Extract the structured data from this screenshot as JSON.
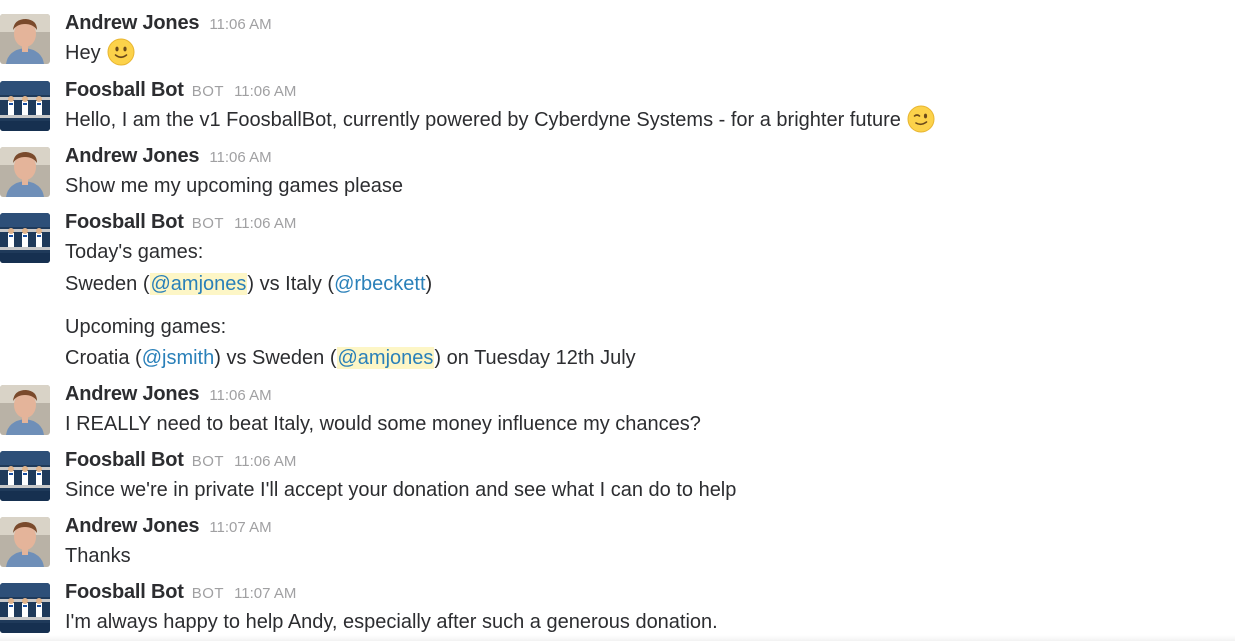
{
  "messages": [
    {
      "author": "Andrew Jones",
      "is_bot": false,
      "time": "11:06 AM",
      "lines": [
        "Hey"
      ],
      "emoji": "slightly-smiling-face-icon"
    },
    {
      "author": "Foosball Bot",
      "is_bot": true,
      "bot_tag": "BOT",
      "time": "11:06 AM",
      "lines": [
        "Hello, I am the v1 FoosballBot, currently powered by Cyberdyne Systems - for a brighter future"
      ],
      "emoji": "winking-face-icon"
    },
    {
      "author": "Andrew Jones",
      "is_bot": false,
      "time": "11:06 AM",
      "lines": [
        "Show me my upcoming games please"
      ]
    },
    {
      "author": "Foosball Bot",
      "is_bot": true,
      "bot_tag": "BOT",
      "time": "11:06 AM",
      "todays_label": "Today's games:",
      "todays_game": {
        "team1": "Sweden (",
        "player1": "@amjones",
        "vs": ") vs Italy (",
        "player2": "@rbeckett",
        "end": ")"
      },
      "upcoming_label": "Upcoming games:",
      "upcoming_game": {
        "team1": "Croatia (",
        "player1": "@jsmith",
        "vs": ") vs Sweden (",
        "player2": "@amjones",
        "end": ") on Tuesday 12th July"
      }
    },
    {
      "author": "Andrew Jones",
      "is_bot": false,
      "time": "11:06 AM",
      "lines": [
        "I REALLY need to beat Italy, would some money influence my chances?"
      ]
    },
    {
      "author": "Foosball Bot",
      "is_bot": true,
      "bot_tag": "BOT",
      "time": "11:06 AM",
      "lines": [
        "Since we're in private I'll accept your donation and see what I can do to help"
      ]
    },
    {
      "author": "Andrew Jones",
      "is_bot": false,
      "time": "11:07 AM",
      "lines": [
        "Thanks"
      ]
    },
    {
      "author": "Foosball Bot",
      "is_bot": true,
      "bot_tag": "BOT",
      "time": "11:07 AM",
      "lines": [
        "I'm always happy to help Andy, especially after such a generous donation."
      ]
    }
  ],
  "colors": {
    "author": "#2c2d30",
    "text": "#2c2d30",
    "meta": "#a0a0a2",
    "mention": "#2a80b9",
    "mention_highlight": "#fdf6c6"
  }
}
